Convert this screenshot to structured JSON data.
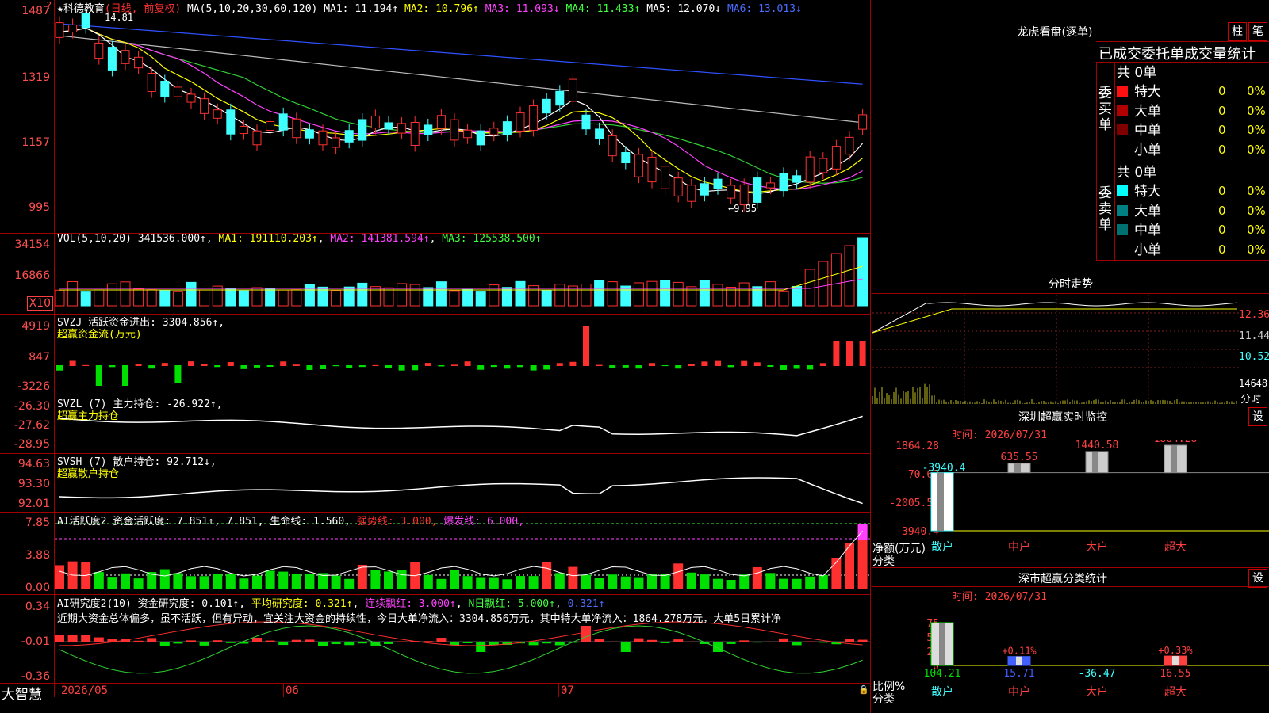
{
  "app": {
    "brand": "大智慧"
  },
  "price": {
    "stock": "科德教育",
    "mode": "(日线, 前复权)",
    "ma_label": "MA(5,10,20,30,60,120)",
    "ma1": "MA1: 11.194↑",
    "ma2": "MA2: 10.796↑",
    "ma3": "MA3: 11.093↓",
    "ma4": "MA4: 11.433↑",
    "ma5": "MA5: 12.070↓",
    "ma6": "MA6: 13.013↓",
    "high_label": "14.81",
    "low_label": "9.95",
    "axis": [
      "1487",
      "1319",
      "1157",
      "995"
    ]
  },
  "volume": {
    "header": "VOL(5,10,20)",
    "value": "341536.000↑",
    "ma1": "MA1: 191110.203↑",
    "ma2": "MA2: 141381.594↑",
    "ma3": "MA3: 125538.500↑",
    "axis": [
      "34154",
      "16866"
    ],
    "unit": "X10"
  },
  "svzj": {
    "header": "SVZJ  活跃资金进出: 3304.856↑,",
    "sub": "超赢资金流(万元)",
    "axis": [
      "4919",
      "847",
      "-3226"
    ]
  },
  "svzl": {
    "header": "SVZL (7) 主力持仓: -26.922↑,",
    "sub": "超赢主力持仓",
    "axis": [
      "-26.30",
      "-27.62",
      "-28.95"
    ]
  },
  "svsh": {
    "header": "SVSH (7) 散户持仓: 92.712↓,",
    "sub": "超赢散户持仓",
    "axis": [
      "94.63",
      "93.30",
      "92.01"
    ]
  },
  "ai1": {
    "name": "AI活跃度2",
    "a": "资金活跃度: 7.851↑",
    "b": "7.851,",
    "c": "生命线: 1.560,",
    "d": "强势线: 3.000,",
    "e": "爆发线: 6.000,",
    "axis": [
      "7.85",
      "3.88",
      "0.00"
    ]
  },
  "ai2": {
    "name": "AI研究度2(10)",
    "a": "资金研究度: 0.101↑",
    "b": "平均研究度: 0.321↑",
    "c": "连续飘红: 3.000↑",
    "d": "N日飘红: 5.000↑",
    "e": "0.321↑",
    "text": "近期大资金总体偏多，虽不活跃，但有异动，宜关注大资金的持续性，今日大单净流入：3304.856万元，其中特大单净流入：1864.278万元，大单5日累计净",
    "axis": [
      "0.34",
      "-0.01",
      "-0.36"
    ]
  },
  "dates": [
    "2026/05",
    "06",
    "07"
  ],
  "longhu": {
    "title": "龙虎看盘(逐单)",
    "btn1": "柱",
    "btn2": "笔",
    "tab_label": "已成交委托单成交量统计",
    "buy_label": "委买单",
    "sell_label": "委卖单",
    "buy_total": "共 0单",
    "sell_total": "共 0单",
    "buy_rows": [
      {
        "label": "特大",
        "value": "0",
        "pct": "0%"
      },
      {
        "label": "大单",
        "value": "0",
        "pct": "0%"
      },
      {
        "label": "中单",
        "value": "0",
        "pct": "0%"
      },
      {
        "label": "小单",
        "value": "0",
        "pct": "0%"
      }
    ],
    "sell_rows": [
      {
        "label": "特大",
        "value": "0",
        "pct": "0%"
      },
      {
        "label": "大单",
        "value": "0",
        "pct": "0%"
      },
      {
        "label": "中单",
        "value": "0",
        "pct": "0%"
      },
      {
        "label": "小单",
        "value": "0",
        "pct": "0%"
      }
    ]
  },
  "fenshi": {
    "title": "分时走势",
    "axis": [
      "12.36",
      "11.44",
      "10.52"
    ],
    "vol": "14648",
    "tag": "分时"
  },
  "monitor": {
    "title": "深圳超赢实时监控",
    "btn": "设",
    "time": "时间: 2026/07/31",
    "axis": [
      "1864.28",
      "-70.62",
      "-2005.51",
      "-3940.4"
    ],
    "left_label_a": "净额(万元)",
    "left_label_b": "分类",
    "bars": [
      {
        "label": "散户",
        "value": -3940.4,
        "text": "-3940.4"
      },
      {
        "label": "中户",
        "value": 635.55,
        "text": "635.55"
      },
      {
        "label": "大户",
        "value": 1440.58,
        "text": "1440.58"
      },
      {
        "label": "超大",
        "value": 1864.28,
        "text": "1864.28"
      }
    ]
  },
  "classstat": {
    "title": "深市超赢分类统计",
    "btn": "设",
    "time": "时间: 2026/07/31",
    "axis": [
      "75",
      "50",
      "25",
      "0"
    ],
    "left_label_a": "比例%",
    "left_label_b": "分类",
    "bars": [
      {
        "label": "散户",
        "value": 104.21,
        "text": "104.21",
        "delta": ""
      },
      {
        "label": "中户",
        "value": 15.71,
        "text": "15.71",
        "delta": "+0.11%"
      },
      {
        "label": "大户",
        "value": -36.47,
        "text": "-36.47",
        "delta": ""
      },
      {
        "label": "超大",
        "value": 16.55,
        "text": "16.55",
        "delta": "+0.33%"
      }
    ]
  }
}
